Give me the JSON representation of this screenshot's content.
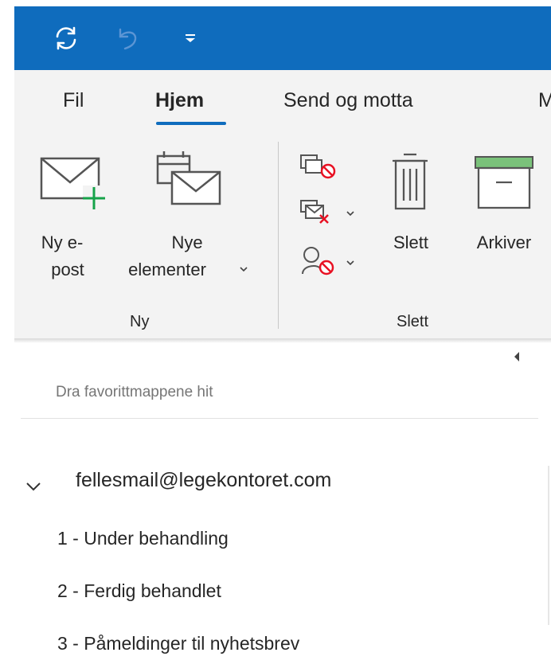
{
  "titlebar": {
    "bg": "#0f6cbd",
    "icons": [
      "sync-icon",
      "undo-icon",
      "customize-quick-access-icon"
    ]
  },
  "ribbon": {
    "tabs": [
      {
        "label": "Fil"
      },
      {
        "label": "Hjem",
        "active": true
      },
      {
        "label": "Send og motta"
      },
      {
        "label": "M"
      }
    ],
    "new_group": {
      "label": "Ny",
      "new_email_line1": "Ny e-",
      "new_email_line2": "post",
      "new_items_line1": "Nye",
      "new_items_line2": "elementer"
    },
    "delete_group": {
      "label": "Slett",
      "delete": "Slett",
      "archive": "Arkiver"
    }
  },
  "nav": {
    "favorites_hint": "Dra favorittmappene hit",
    "account": "fellesmail@legekontoret.com",
    "folders": [
      "1 - Under behandling",
      "2 - Ferdig behandlet",
      "3 - Påmeldinger til nyhetsbrev"
    ]
  },
  "colors": {
    "accent": "#0f6cbd",
    "green": "#16a34a",
    "red": "#e81123"
  }
}
